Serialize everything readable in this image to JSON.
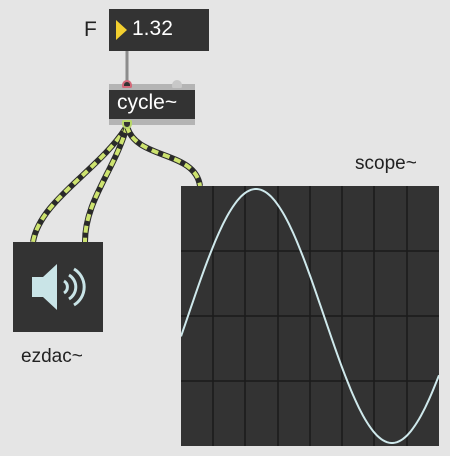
{
  "number_box": {
    "prefix_label": "F",
    "value": "1.32"
  },
  "cycle_object": {
    "label": "cycle~"
  },
  "scope_object": {
    "label": "scope~"
  },
  "ezdac_object": {
    "label": "ezdac~",
    "icon": "speaker-icon"
  },
  "colors": {
    "canvas_background": "#e5e5e5",
    "object_background": "#333333",
    "number_triangle": "#f2cf2f",
    "signal_cable_dash": "#cde36f",
    "signal_cable_base": "#2a2a2a",
    "scope_trace": "#cfe9ec",
    "scope_grid": "#1a1a1a",
    "speaker_icon": "#c9e4e7"
  }
}
